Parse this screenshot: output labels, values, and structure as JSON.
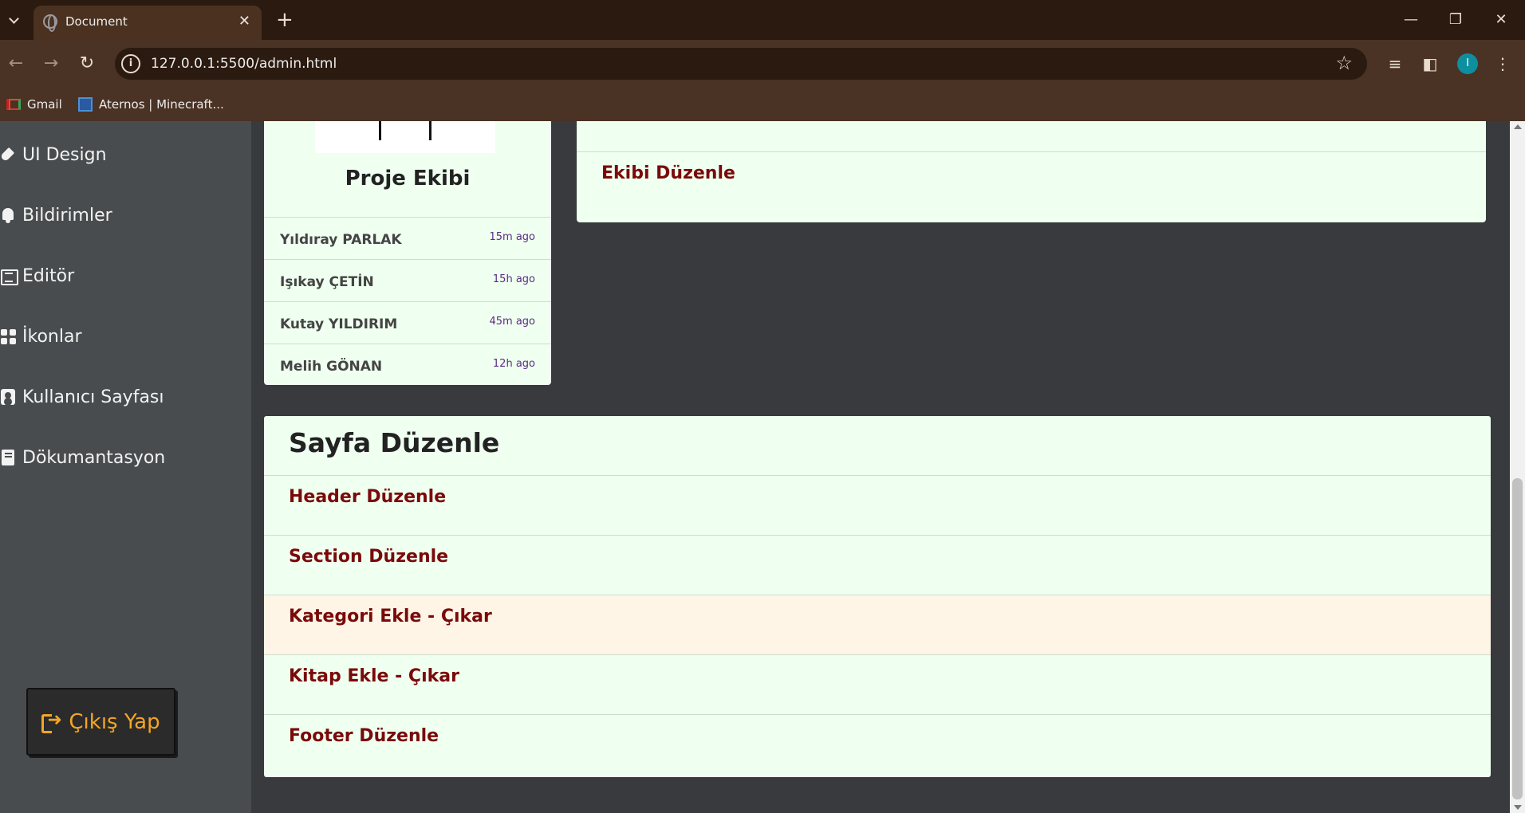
{
  "browser": {
    "tab_title": "Document",
    "url": "127.0.0.1:5500/admin.html",
    "profile_initial": "I",
    "bookmarks": [
      {
        "label": "Gmail",
        "icon": "gmail-icon"
      },
      {
        "label": "Aternos | Minecraft...",
        "icon": "aternos-icon"
      }
    ]
  },
  "sidebar": {
    "items": [
      {
        "label": "UI Design",
        "icon": "pen-nib-icon"
      },
      {
        "label": "Bildirimler",
        "icon": "bell-icon"
      },
      {
        "label": "Editör",
        "icon": "newspaper-icon"
      },
      {
        "label": "İkonlar",
        "icon": "icons-icon"
      },
      {
        "label": "Kullanıcı Sayfası",
        "icon": "user-card-icon"
      },
      {
        "label": "Dökumantasyon",
        "icon": "book-icon"
      }
    ],
    "logout_label": "Çıkış Yap"
  },
  "team": {
    "title": "Proje Ekibi",
    "members": [
      {
        "name": "Yıldıray PARLAK",
        "time": "15m ago"
      },
      {
        "name": "Işıkay ÇETİN",
        "time": "15h ago"
      },
      {
        "name": "Kutay YILDIRIM",
        "time": "45m ago"
      },
      {
        "name": "Melih GÖNAN",
        "time": "12h ago"
      }
    ]
  },
  "ekip": {
    "link": "Ekibi Düzenle"
  },
  "sayfa": {
    "title": "Sayfa Düzenle",
    "items": [
      "Header Düzenle",
      "Section Düzenle",
      "Kategori Ekle - Çıkar",
      "Kitap Ekle - Çıkar",
      "Footer Düzenle"
    ]
  },
  "colors": {
    "accent_link": "#7a0a0a",
    "logout_text": "#f5a623",
    "card_bg": "#effff0",
    "hover_bg": "#fff5e6"
  }
}
